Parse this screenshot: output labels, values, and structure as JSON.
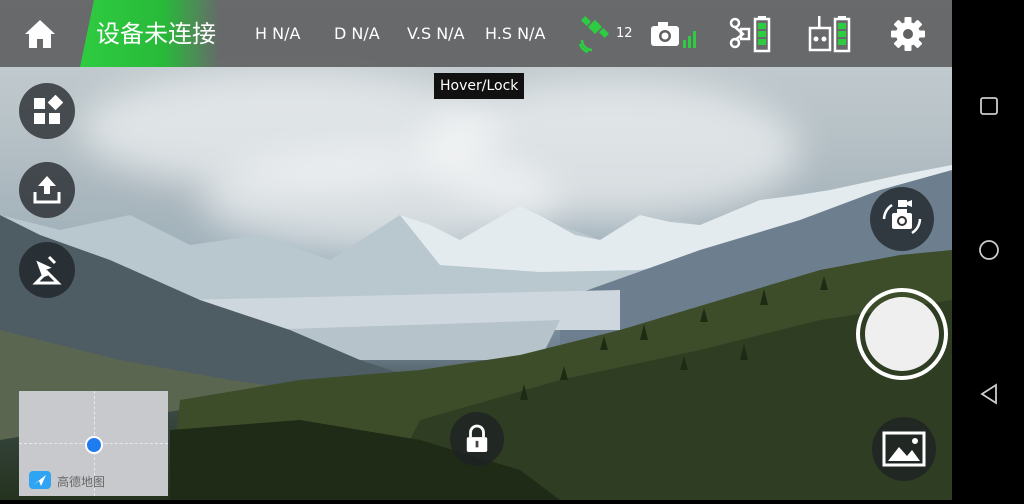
{
  "status": {
    "connection": "设备未连接"
  },
  "metrics": [
    {
      "label": "H N/A"
    },
    {
      "label": "D N/A"
    },
    {
      "label": "V.S N/A"
    },
    {
      "label": "H.S N/A"
    }
  ],
  "gps": {
    "satellites": "12"
  },
  "tooltip": {
    "text": "Hover/Lock"
  },
  "map": {
    "provider": "高德地图"
  },
  "colors": {
    "accent": "#2ecc40",
    "topbar": "#5f6162",
    "battery": "#2ecc40"
  }
}
